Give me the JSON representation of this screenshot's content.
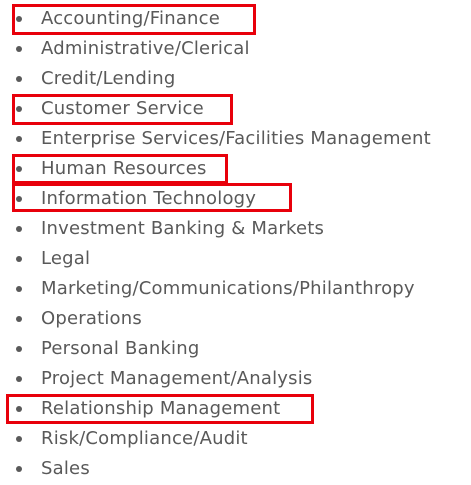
{
  "items": [
    {
      "label": "Accounting/Finance",
      "highlighted": true
    },
    {
      "label": "Administrative/Clerical",
      "highlighted": false
    },
    {
      "label": "Credit/Lending",
      "highlighted": false
    },
    {
      "label": "Customer Service",
      "highlighted": true
    },
    {
      "label": "Enterprise Services/Facilities Management",
      "highlighted": false
    },
    {
      "label": "Human Resources",
      "highlighted": true
    },
    {
      "label": "Information Technology",
      "highlighted": true
    },
    {
      "label": "Investment Banking & Markets",
      "highlighted": false
    },
    {
      "label": "Legal",
      "highlighted": false
    },
    {
      "label": "Marketing/Communications/Philanthropy",
      "highlighted": false
    },
    {
      "label": "Operations",
      "highlighted": false
    },
    {
      "label": "Personal Banking",
      "highlighted": false
    },
    {
      "label": "Project Management/Analysis",
      "highlighted": false
    },
    {
      "label": "Relationship Management",
      "highlighted": true
    },
    {
      "label": "Risk/Compliance/Audit",
      "highlighted": false
    },
    {
      "label": "Sales",
      "highlighted": false
    }
  ],
  "colors": {
    "text": "#595959",
    "highlight_border": "#e8000b"
  }
}
